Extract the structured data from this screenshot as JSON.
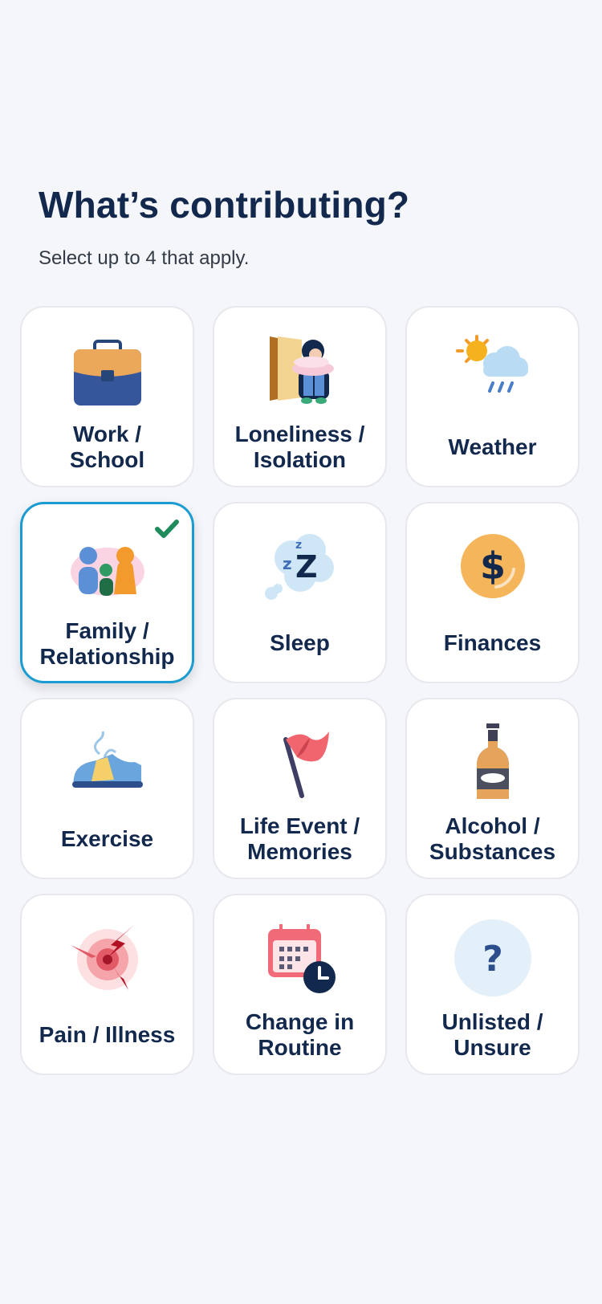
{
  "header": {
    "title": "What’s contributing?",
    "subtitle": "Select up to 4 that apply."
  },
  "options": [
    {
      "label": "Work /\nSchool",
      "icon": "briefcase-icon",
      "selected": false
    },
    {
      "label": "Loneliness /\nIsolation",
      "icon": "lonely-person-icon",
      "selected": false
    },
    {
      "label": "Weather",
      "icon": "weather-icon",
      "selected": false
    },
    {
      "label": "Family /\nRelationship",
      "icon": "family-icon",
      "selected": true
    },
    {
      "label": "Sleep",
      "icon": "sleep-icon",
      "selected": false
    },
    {
      "label": "Finances",
      "icon": "dollar-coin-icon",
      "selected": false
    },
    {
      "label": "Exercise",
      "icon": "sneaker-icon",
      "selected": false
    },
    {
      "label": "Life Event /\nMemories",
      "icon": "flag-icon",
      "selected": false
    },
    {
      "label": "Alcohol /\nSubstances",
      "icon": "bottle-icon",
      "selected": false
    },
    {
      "label": "Pain / Illness",
      "icon": "pain-target-icon",
      "selected": false
    },
    {
      "label": "Change in\nRoutine",
      "icon": "calendar-clock-icon",
      "selected": false
    },
    {
      "label": "Unlisted /\nUnsure",
      "icon": "question-icon",
      "selected": false
    }
  ],
  "colors": {
    "title": "#12284c",
    "selected_border": "#1a9bd1",
    "check": "#1f8a5b",
    "background": "#f5f6fa"
  }
}
